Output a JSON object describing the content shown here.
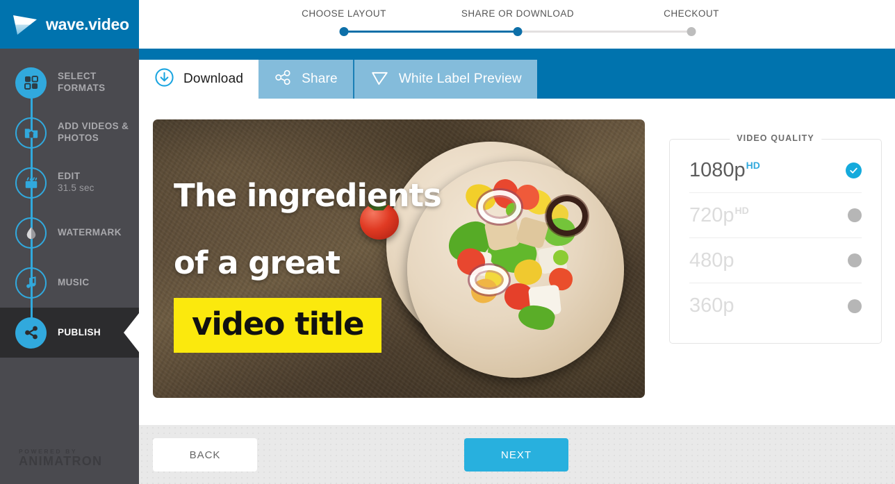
{
  "brand": {
    "name": "wave.video",
    "logo_icon": "wave-play-logo-icon"
  },
  "progress": {
    "steps": [
      {
        "label": "CHOOSE LAYOUT",
        "state": "done"
      },
      {
        "label": "SHARE OR DOWNLOAD",
        "state": "done"
      },
      {
        "label": "CHECKOUT",
        "state": "todo"
      }
    ]
  },
  "sidebar": {
    "items": [
      {
        "label": "SELECT FORMATS",
        "sub": "",
        "icon": "formats-icon",
        "style": "filled",
        "active": false
      },
      {
        "label": "ADD VIDEOS & PHOTOS",
        "sub": "",
        "icon": "media-folder-icon",
        "style": "outline",
        "active": false
      },
      {
        "label": "EDIT",
        "sub": "31.5 sec",
        "icon": "clapperboard-icon",
        "style": "outline",
        "active": false
      },
      {
        "label": "WATERMARK",
        "sub": "",
        "icon": "droplet-icon",
        "style": "outline",
        "active": false
      },
      {
        "label": "MUSIC",
        "sub": "",
        "icon": "music-note-icon",
        "style": "outline",
        "active": false
      },
      {
        "label": "PUBLISH",
        "sub": "",
        "icon": "share-nodes-icon",
        "style": "filled",
        "active": true
      }
    ],
    "footer": {
      "powered_by": "POWERED BY",
      "company": "ANIMATRON"
    }
  },
  "tabs": [
    {
      "label": "Download",
      "icon": "download-circle-icon",
      "active": true
    },
    {
      "label": "Share",
      "icon": "share-nodes-icon",
      "active": false
    },
    {
      "label": "White Label Preview",
      "icon": "play-triangle-icon",
      "active": false
    }
  ],
  "preview": {
    "title_line1": "The ingredients",
    "title_line2": "of a great",
    "highlight": "video title",
    "highlight_color": "#fbe90d",
    "scene": "taco-with-vegetables-on-stone"
  },
  "quality": {
    "title": "VIDEO QUALITY",
    "options": [
      {
        "label": "1080p",
        "badge": "HD",
        "selected": true,
        "disabled": false
      },
      {
        "label": "720p",
        "badge": "HD",
        "selected": false,
        "disabled": true
      },
      {
        "label": "480p",
        "badge": "",
        "selected": false,
        "disabled": true
      },
      {
        "label": "360p",
        "badge": "",
        "selected": false,
        "disabled": true
      }
    ]
  },
  "footer": {
    "back": "BACK",
    "next": "NEXT"
  },
  "colors": {
    "brand_blue": "#0073ae",
    "accent_cyan": "#31a9dd",
    "next_blue": "#28b0de",
    "sidebar_bg": "#4a4a4f",
    "sidebar_active_bg": "#2c2c2e",
    "tab_inactive": "#84bcdb"
  }
}
